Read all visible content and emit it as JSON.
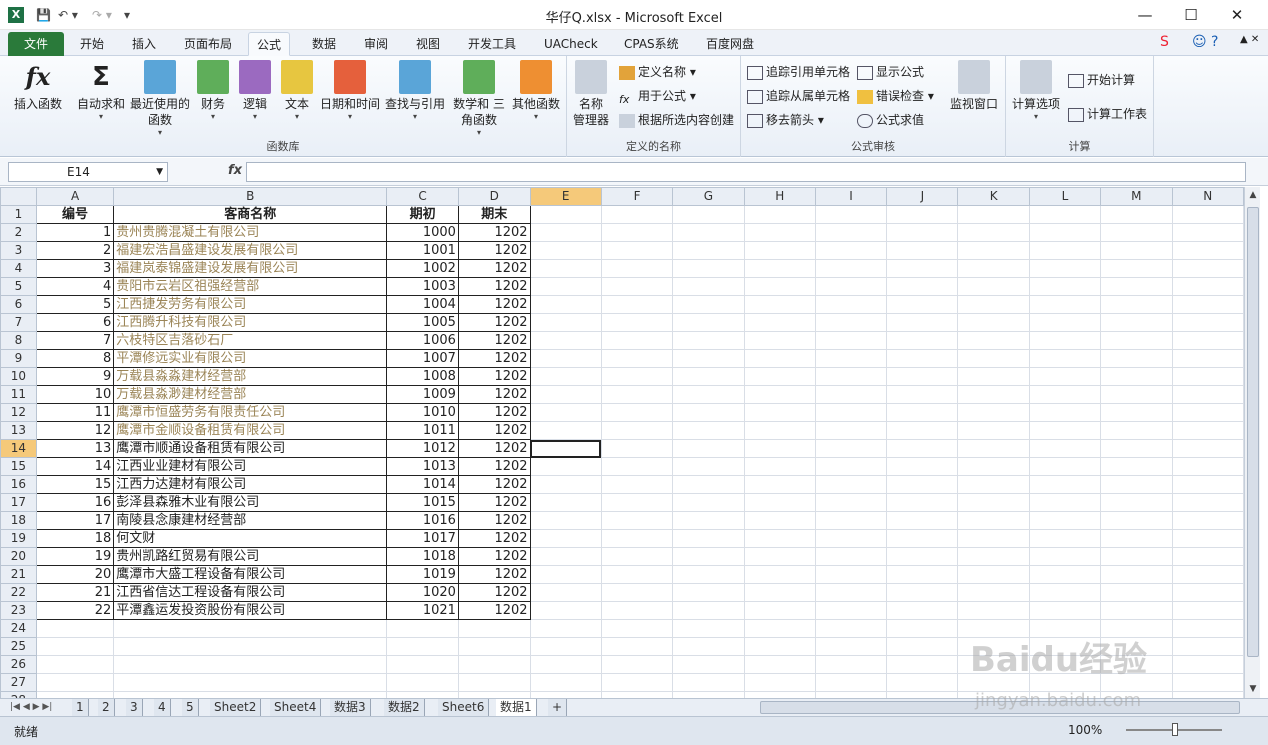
{
  "title": "华仔Q.xlsx - Microsoft Excel",
  "window": {
    "min": "—",
    "max": "☐",
    "close": "✕"
  },
  "tabs": [
    "文件",
    "开始",
    "插入",
    "页面布局",
    "公式",
    "数据",
    "审阅",
    "视图",
    "开发工具",
    "UACheck",
    "CPAS系统",
    "百度网盘"
  ],
  "ribbon": {
    "func_lib": {
      "label": "函数库",
      "buttons": [
        "插入函数",
        "自动求和",
        "最近使用的 函数",
        "财务",
        "逻辑",
        "文本",
        "日期和时间",
        "查找与引用",
        "数学和 三角函数",
        "其他函数"
      ]
    },
    "names": {
      "label": "定义的名称",
      "big": "名称 管理器",
      "small": [
        "定义名称 ▾",
        "用于公式 ▾",
        "根据所选内容创建"
      ]
    },
    "audit": {
      "label": "公式审核",
      "small": [
        "追踪引用单元格",
        "追踪从属单元格",
        "移去箭头 ▾",
        "显示公式",
        "错误检查 ▾",
        "公式求值"
      ],
      "watch": "监视窗口"
    },
    "calc": {
      "label": "计算",
      "options": "计算选项",
      "small": [
        "开始计算",
        "计算工作表"
      ]
    }
  },
  "namebox": "E14",
  "columns": [
    "A",
    "B",
    "C",
    "D",
    "E",
    "F",
    "G",
    "H",
    "I",
    "J",
    "K",
    "L",
    "M",
    "N"
  ],
  "headers": {
    "a": "编号",
    "b": "客商名称",
    "c": "期初",
    "d": "期末"
  },
  "rows": [
    [
      1,
      "贵州贵腾混凝土有限公司",
      1000,
      1202,
      true
    ],
    [
      2,
      "福建宏浩昌盛建设发展有限公司",
      1001,
      1202,
      true
    ],
    [
      3,
      "福建岚泰锦盛建设发展有限公司",
      1002,
      1202,
      true
    ],
    [
      4,
      "贵阳市云岩区祖强经营部",
      1003,
      1202,
      true
    ],
    [
      5,
      "江西捷发劳务有限公司",
      1004,
      1202,
      true
    ],
    [
      6,
      "江西腾升科技有限公司",
      1005,
      1202,
      true
    ],
    [
      7,
      "六枝特区吉落砂石厂",
      1006,
      1202,
      true
    ],
    [
      8,
      "平潭修远实业有限公司",
      1007,
      1202,
      true
    ],
    [
      9,
      "万载县淼淼建材经营部",
      1008,
      1202,
      true
    ],
    [
      10,
      "万载县淼渺建材经营部",
      1009,
      1202,
      true
    ],
    [
      11,
      "鹰潭市恒盛劳务有限责任公司",
      1010,
      1202,
      true
    ],
    [
      12,
      "鹰潭市金顺设备租赁有限公司",
      1011,
      1202,
      true
    ],
    [
      13,
      "鹰潭市顺通设备租赁有限公司",
      1012,
      1202,
      false
    ],
    [
      14,
      "江西业业建材有限公司",
      1013,
      1202,
      false
    ],
    [
      15,
      "江西力达建材有限公司",
      1014,
      1202,
      false
    ],
    [
      16,
      "彭泽县森雅木业有限公司",
      1015,
      1202,
      false
    ],
    [
      17,
      "南陵县念康建材经营部",
      1016,
      1202,
      false
    ],
    [
      18,
      "何文财",
      1017,
      1202,
      false
    ],
    [
      19,
      "贵州凯路红贸易有限公司",
      1018,
      1202,
      false
    ],
    [
      20,
      "鹰潭市大盛工程设备有限公司",
      1019,
      1202,
      false
    ],
    [
      21,
      "江西省信达工程设备有限公司",
      1020,
      1202,
      false
    ],
    [
      22,
      "平潭鑫运发投资股份有限公司",
      1021,
      1202,
      false
    ]
  ],
  "sheets": [
    "1",
    "2",
    "3",
    "4",
    "5",
    "Sheet2",
    "Sheet4",
    "数据3",
    "数据2",
    "Sheet6",
    "数据1"
  ],
  "status": {
    "ready": "就绪",
    "zoom": "100%"
  },
  "watermark": "Baidu经验",
  "watermark2": "jingyan.baidu.com"
}
